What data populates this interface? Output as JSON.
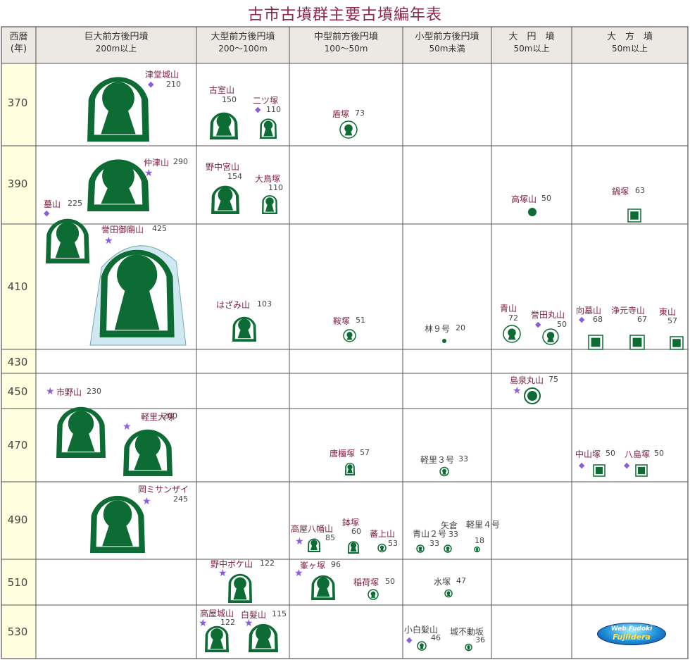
{
  "title": "古市古墳群主要古墳編年表",
  "headers": [
    {
      "key": "year",
      "line1": "西暦",
      "line2": "(年)"
    },
    {
      "key": "giant",
      "line1": "巨大前方後円墳",
      "line2": "200m以上"
    },
    {
      "key": "large",
      "line1": "大型前方後円墳",
      "line2": "200〜100m"
    },
    {
      "key": "medium",
      "line1": "中型前方後円墳",
      "line2": "100〜50m"
    },
    {
      "key": "small",
      "line1": "小型前方後円墳",
      "line2": "50m未満"
    },
    {
      "key": "round",
      "line1": "大　円　墳",
      "line2": "50m以上"
    },
    {
      "key": "square",
      "line1": "大　方　墳",
      "line2": "50m以上"
    }
  ],
  "years": [
    "370",
    "390",
    "410",
    "430",
    "450",
    "470",
    "490",
    "510",
    "530"
  ],
  "colors": {
    "accent": "#8e2848",
    "mound": "#0d6b34",
    "moat": "#ffffff",
    "outer_moat": "#cfe8f2",
    "year_column": "#ffffe0",
    "header_bg": "#ece8e4",
    "star": "#8a5ce0"
  },
  "tombs": [
    {
      "name": "津堂城山",
      "size": "210",
      "mark": "diamond",
      "period": "370",
      "category": "giant"
    },
    {
      "name": "古室山",
      "size": "150",
      "mark": "",
      "period": "370",
      "category": "large"
    },
    {
      "name": "二ツ塚",
      "size": "110",
      "mark": "diamond",
      "period": "370",
      "category": "large"
    },
    {
      "name": "盾塚",
      "size": "73",
      "mark": "",
      "period": "370",
      "category": "medium"
    },
    {
      "name": "仲津山",
      "size": "290",
      "mark": "star",
      "period": "390",
      "category": "giant"
    },
    {
      "name": "野中宮山",
      "size": "154",
      "mark": "",
      "period": "390",
      "category": "large"
    },
    {
      "name": "大鳥塚",
      "size": "110",
      "mark": "",
      "period": "390",
      "category": "large"
    },
    {
      "name": "高塚山",
      "size": "50",
      "mark": "",
      "period": "390",
      "category": "round"
    },
    {
      "name": "鍋塚",
      "size": "63",
      "mark": "",
      "period": "390",
      "category": "square"
    },
    {
      "name": "墓山",
      "size": "225",
      "mark": "diamond",
      "period": "410",
      "category": "giant"
    },
    {
      "name": "誉田御廟山",
      "size": "425",
      "mark": "star",
      "period": "410",
      "category": "giant"
    },
    {
      "name": "はざみ山",
      "size": "103",
      "mark": "",
      "period": "410",
      "category": "large"
    },
    {
      "name": "鞍塚",
      "size": "51",
      "mark": "",
      "period": "410",
      "category": "medium"
    },
    {
      "name": "林９号",
      "size": "20",
      "mark": "",
      "period": "410",
      "category": "small"
    },
    {
      "name": "青山",
      "size": "72",
      "mark": "",
      "period": "410",
      "category": "round"
    },
    {
      "name": "誉田丸山",
      "size": "50",
      "mark": "diamond",
      "period": "410",
      "category": "round"
    },
    {
      "name": "向墓山",
      "size": "68",
      "mark": "diamond",
      "period": "410",
      "category": "square"
    },
    {
      "name": "浄元寺山",
      "size": "67",
      "mark": "",
      "period": "410",
      "category": "square"
    },
    {
      "name": "東山",
      "size": "57",
      "mark": "",
      "period": "410",
      "category": "square"
    },
    {
      "name": "市野山",
      "size": "230",
      "mark": "star",
      "period": "450",
      "category": "giant"
    },
    {
      "name": "島泉丸山",
      "size": "75",
      "mark": "star",
      "period": "450",
      "category": "round"
    },
    {
      "name": "軽里大塚",
      "size": "200",
      "mark": "star",
      "period": "470",
      "category": "giant"
    },
    {
      "name": "唐櫃塚",
      "size": "57",
      "mark": "",
      "period": "470",
      "category": "medium"
    },
    {
      "name": "軽里３号",
      "size": "33",
      "mark": "",
      "period": "470",
      "category": "small"
    },
    {
      "name": "中山塚",
      "size": "50",
      "mark": "diamond",
      "period": "470",
      "category": "square"
    },
    {
      "name": "八島塚",
      "size": "50",
      "mark": "diamond",
      "period": "470",
      "category": "square"
    },
    {
      "name": "岡ミサンザイ",
      "size": "245",
      "mark": "star",
      "period": "490",
      "category": "giant"
    },
    {
      "name": "高屋八幡山",
      "size": "85",
      "mark": "star",
      "period": "490",
      "category": "medium"
    },
    {
      "name": "鉢塚",
      "size": "60",
      "mark": "",
      "period": "490",
      "category": "medium"
    },
    {
      "name": "蕃上山",
      "size": "53",
      "mark": "",
      "period": "490",
      "category": "medium"
    },
    {
      "name": "青山２号",
      "size": "33",
      "mark": "",
      "period": "490",
      "category": "small"
    },
    {
      "name": "矢倉",
      "size": "33",
      "mark": "",
      "period": "490",
      "category": "small"
    },
    {
      "name": "軽里４号",
      "size": "18",
      "mark": "",
      "period": "490",
      "category": "small"
    },
    {
      "name": "野中ボケ山",
      "size": "122",
      "mark": "star",
      "period": "510",
      "category": "large"
    },
    {
      "name": "峯ヶ塚",
      "size": "96",
      "mark": "star",
      "period": "510",
      "category": "medium"
    },
    {
      "name": "稲荷塚",
      "size": "50",
      "mark": "",
      "period": "510",
      "category": "medium"
    },
    {
      "name": "水塚",
      "size": "47",
      "mark": "",
      "period": "510",
      "category": "small"
    },
    {
      "name": "高屋城山",
      "size": "122",
      "mark": "star",
      "period": "530",
      "category": "large"
    },
    {
      "name": "白髮山",
      "size": "115",
      "mark": "star",
      "period": "530",
      "category": "large"
    },
    {
      "name": "小白髪山",
      "size": "46",
      "mark": "diamond",
      "period": "530",
      "category": "small"
    },
    {
      "name": "城不動坂",
      "size": "36",
      "mark": "",
      "period": "530",
      "category": "small"
    }
  ],
  "badge": {
    "line1": "Web Fudoki",
    "line2": "Fujiidera"
  }
}
